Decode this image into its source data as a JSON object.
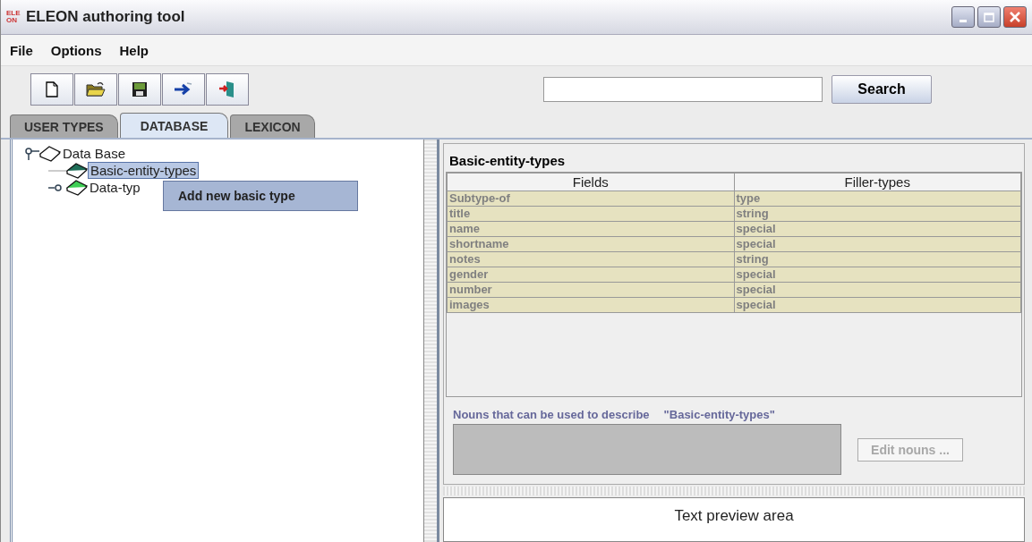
{
  "window": {
    "title": "ELEON authoring tool",
    "logo": "ELE ON"
  },
  "menu": [
    {
      "label": "File"
    },
    {
      "label": "Options"
    },
    {
      "label": "Help"
    }
  ],
  "search": {
    "button": "Search"
  },
  "tabs": [
    {
      "label": "USER TYPES",
      "selected": false
    },
    {
      "label": "DATABASE",
      "selected": true
    },
    {
      "label": "LEXICON",
      "selected": false
    }
  ],
  "tree": [
    {
      "label": "Data Base",
      "expanded": true,
      "selected": false,
      "children": [
        {
          "label": "Basic-entity-types",
          "selected": true,
          "leaf": true
        },
        {
          "label": "Data-typ",
          "selected": false,
          "expanded": false,
          "leaf": false
        }
      ]
    }
  ],
  "context_menu": {
    "items": [
      "Add new basic type"
    ]
  },
  "details": {
    "title": "Basic-entity-types",
    "columns": [
      "Fields",
      "Filler-types"
    ],
    "rows": [
      [
        "Subtype-of",
        "type"
      ],
      [
        "title",
        "string"
      ],
      [
        "name",
        "special"
      ],
      [
        "shortname",
        "special"
      ],
      [
        "notes",
        "string"
      ],
      [
        "gender",
        "special"
      ],
      [
        "number",
        "special"
      ],
      [
        "images",
        "special"
      ]
    ],
    "nouns_label": "Nouns that can be used to describe",
    "nouns_entity": "\"Basic-entity-types\"",
    "edit_button": {
      "label": "Edit nouns ...",
      "disabled": true
    }
  },
  "preview": {
    "text": "Text preview area"
  }
}
